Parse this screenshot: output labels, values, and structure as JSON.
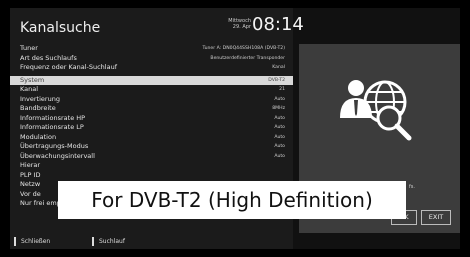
{
  "header": {
    "title": "Kanalsuche",
    "day_name": "Mittwoch",
    "date": "29. Apr",
    "time": "08:14"
  },
  "settings": [
    {
      "label": "Tuner",
      "value": "Tuner A: DN0Q44SSH108A (DVB-T2)"
    },
    {
      "label": "Art des Suchlaufs",
      "value": "Benutzerdefinierter Transponder"
    },
    {
      "label": "Frequenz oder Kanal-Suchlauf",
      "value": "Kanal"
    },
    {
      "label": "System",
      "value": "DVB-T2",
      "selected": true
    },
    {
      "label": "Kanal",
      "value": "21"
    },
    {
      "label": "Invertierung",
      "value": "Auto"
    },
    {
      "label": "Bandbreite",
      "value": "8MHz"
    },
    {
      "label": "Informationsrate HP",
      "value": "Auto"
    },
    {
      "label": "Informationsrate LP",
      "value": "Auto"
    },
    {
      "label": "Modulation",
      "value": "Auto"
    },
    {
      "label": "Übertragungs-Modus",
      "value": "Auto"
    },
    {
      "label": "Überwachungsintervall",
      "value": "Auto"
    },
    {
      "label": "Hierar",
      "value": ""
    },
    {
      "label": "PLP ID",
      "value": ""
    },
    {
      "label": "Netzw",
      "value": ""
    },
    {
      "label": "Vor de",
      "value": ""
    },
    {
      "label": "Nur frei empfangbare",
      "value": "Nein"
    }
  ],
  "footer": {
    "back_label": "Schließen",
    "scan_label": "Suchlauf"
  },
  "dialog": {
    "side_text": "fs.",
    "ok_label": "OK",
    "exit_label": "EXIT"
  },
  "overlay": {
    "caption": "For DVB-T2 (High Definition)"
  },
  "colors": {
    "background": "#111111",
    "panel": "#1b1b1b",
    "selected_row": "#d9d9d9",
    "dialog": "#3c3c3c"
  },
  "icons": [
    "user-globe-search-icon"
  ]
}
